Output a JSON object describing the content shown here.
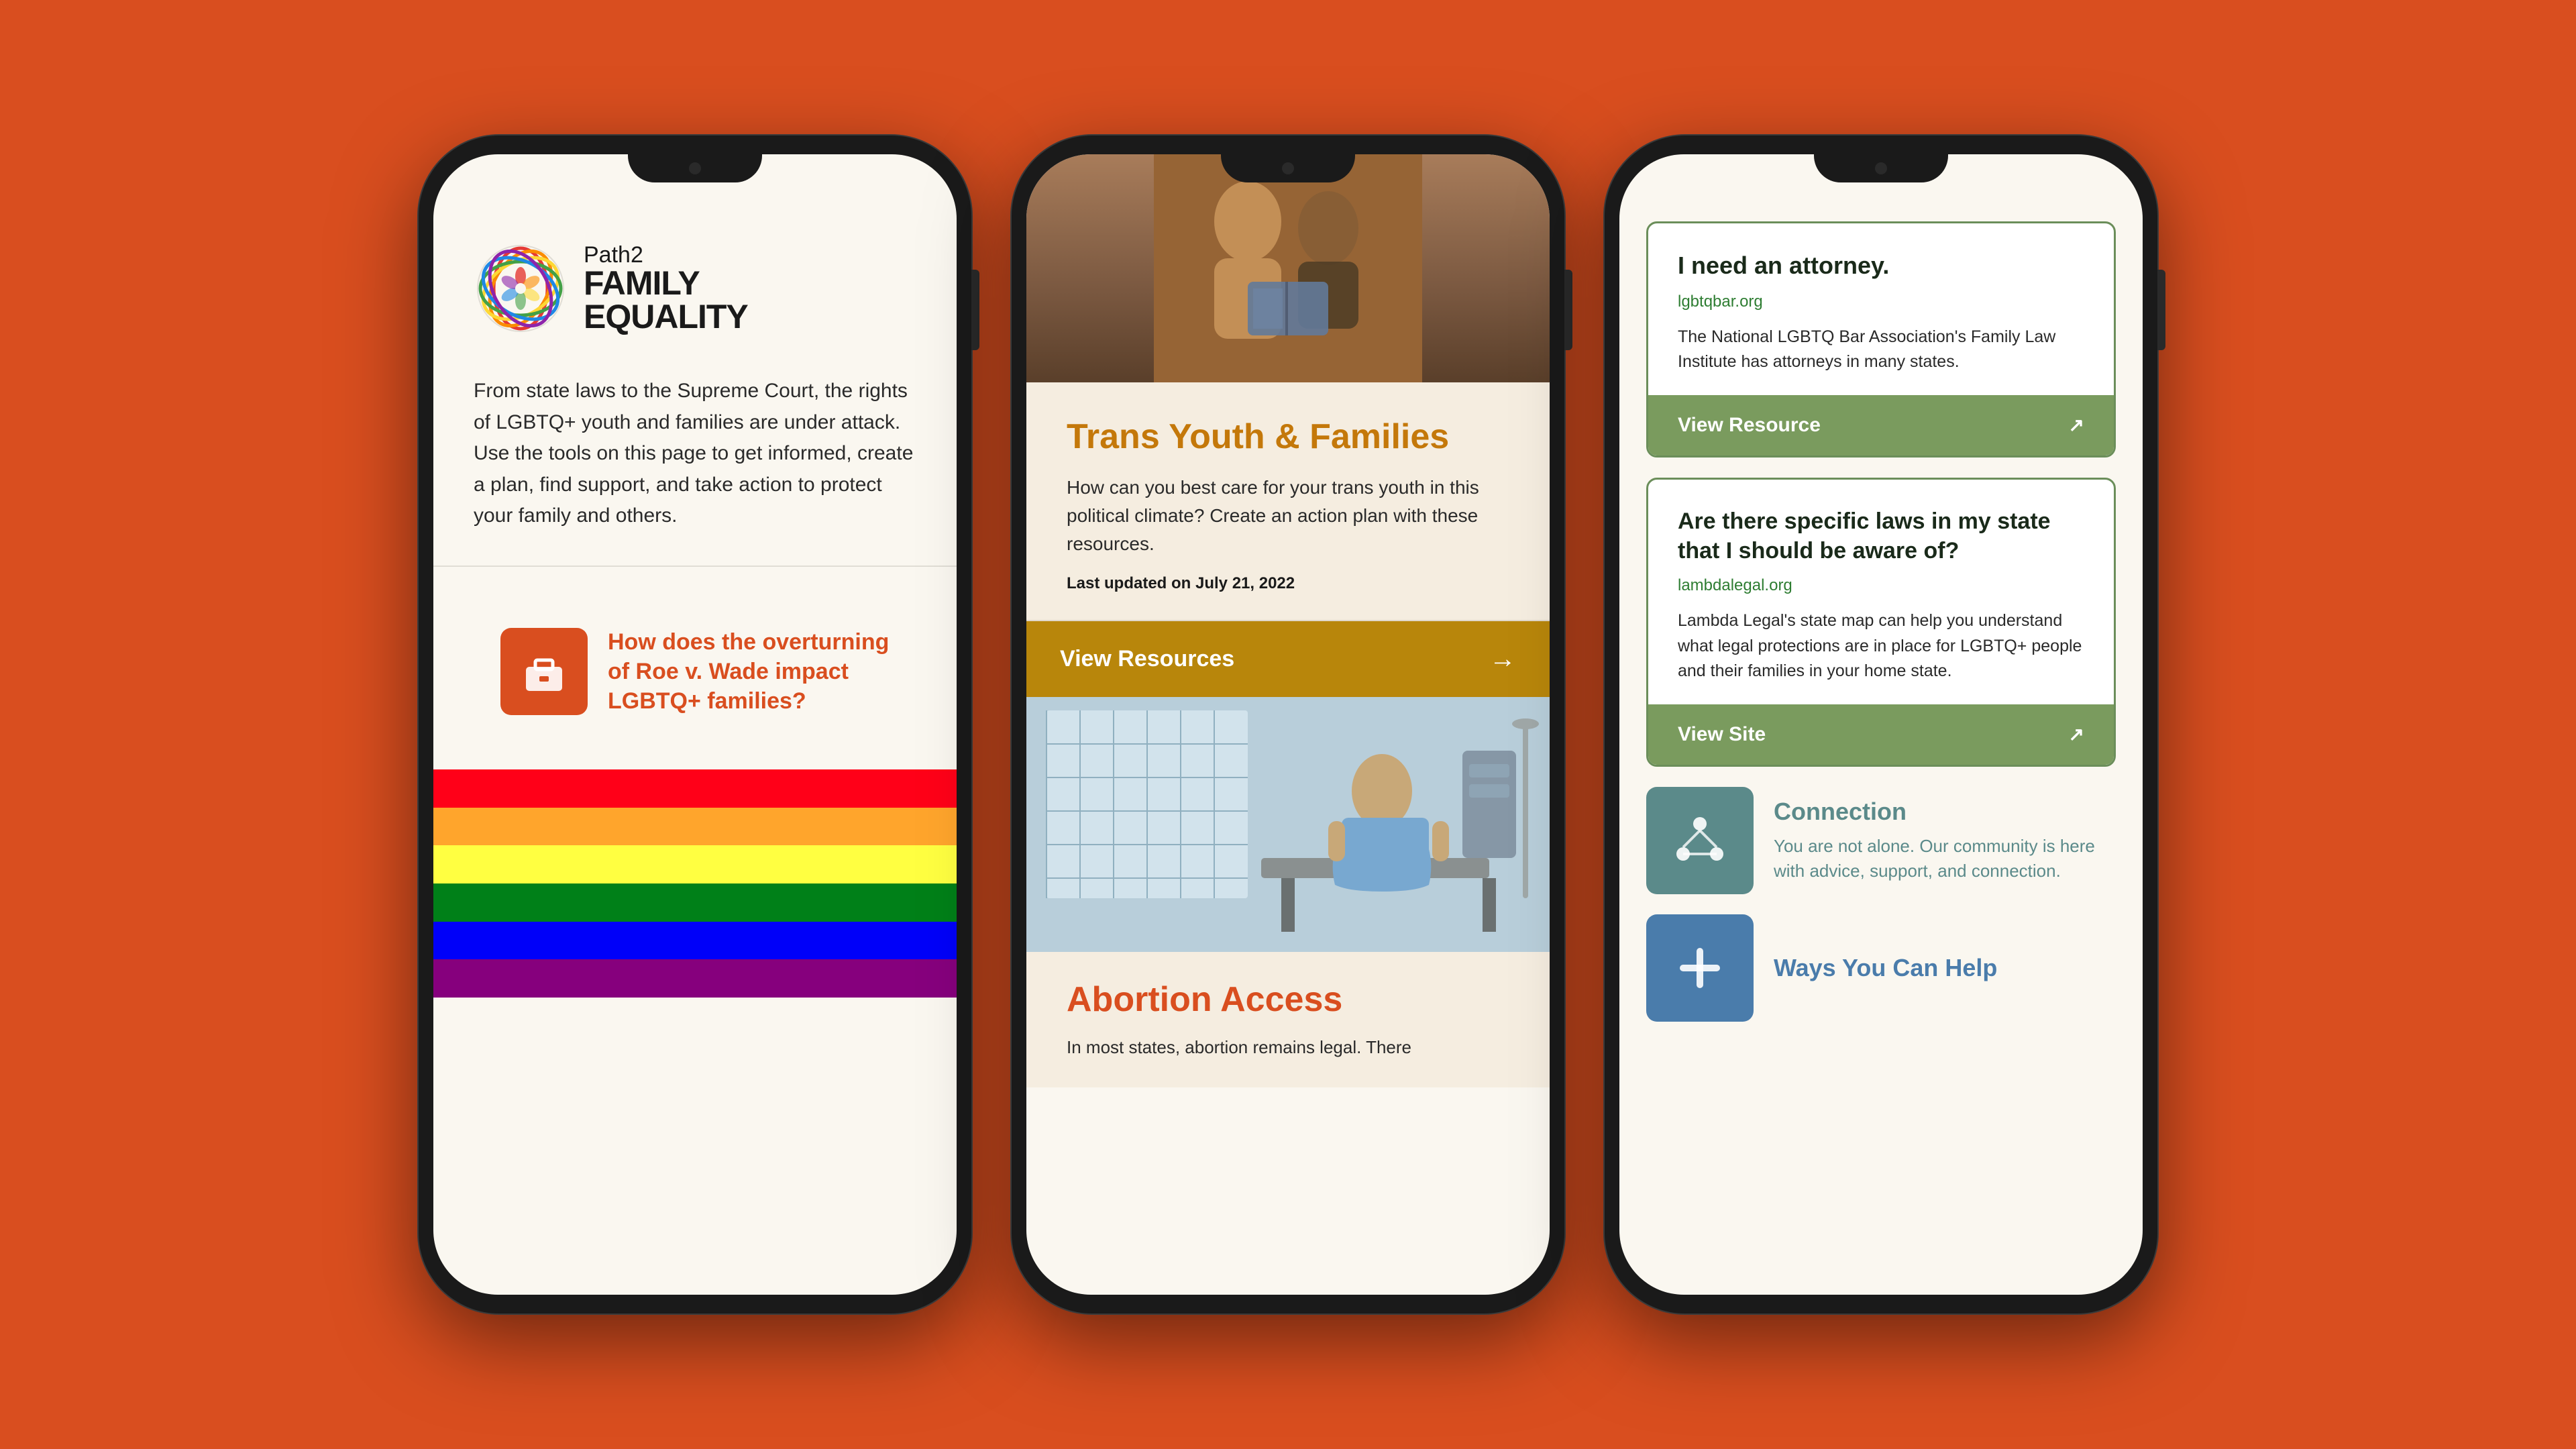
{
  "background": {
    "color": "#D94E1F"
  },
  "phone_left": {
    "logo": {
      "path2": "Path2",
      "family": "FAMILY",
      "equality": "EQUALITY"
    },
    "description": "From state laws to the Supreme Court, the rights of LGBTQ+ youth and families are under attack. Use the tools on this page to get informed, create a plan, find support, and take action to protect your family and others.",
    "card1": {
      "title": "How does the overturning of Roe v. Wade impact LGBTQ+ families?",
      "icon": "🧰"
    }
  },
  "phone_mid": {
    "hero_alt": "Two people reading a book together",
    "card1": {
      "title": "Trans Youth & Families",
      "description": "How can you best care for your trans youth in this political climate? Create an action plan with these resources.",
      "date": "Last updated on July 21, 2022",
      "btn_label": "View Resources"
    },
    "card2": {
      "title": "Abortion Access",
      "description": "In most states, abortion remains legal. There",
      "image_alt": "Person in hospital gown sitting on exam table"
    }
  },
  "phone_right": {
    "card1": {
      "title": "I need an attorney.",
      "source": "lgbtqbar.org",
      "description": "The National LGBTQ Bar Association's Family Law Institute has attorneys in many states.",
      "btn_label": "View Resource",
      "external_icon": "↗"
    },
    "card2": {
      "title": "Are there specific laws in my state that I should be aware of?",
      "source": "lambdalegal.org",
      "description": "Lambda Legal's state map can help you understand what legal protections are in place for LGBTQ+ people and their families in your home state.",
      "btn_label": "View Site",
      "external_icon": "↗"
    },
    "card3": {
      "title": "Connection",
      "description": "You are not alone. Our community is here with advice, support, and connection.",
      "icon": "⟡"
    },
    "card4": {
      "title": "Ways You Can Help",
      "icon": "+"
    }
  },
  "flag_colors": [
    "#FF0018",
    "#FFA52C",
    "#FFFF41",
    "#008018",
    "#0000F9",
    "#86007D"
  ]
}
